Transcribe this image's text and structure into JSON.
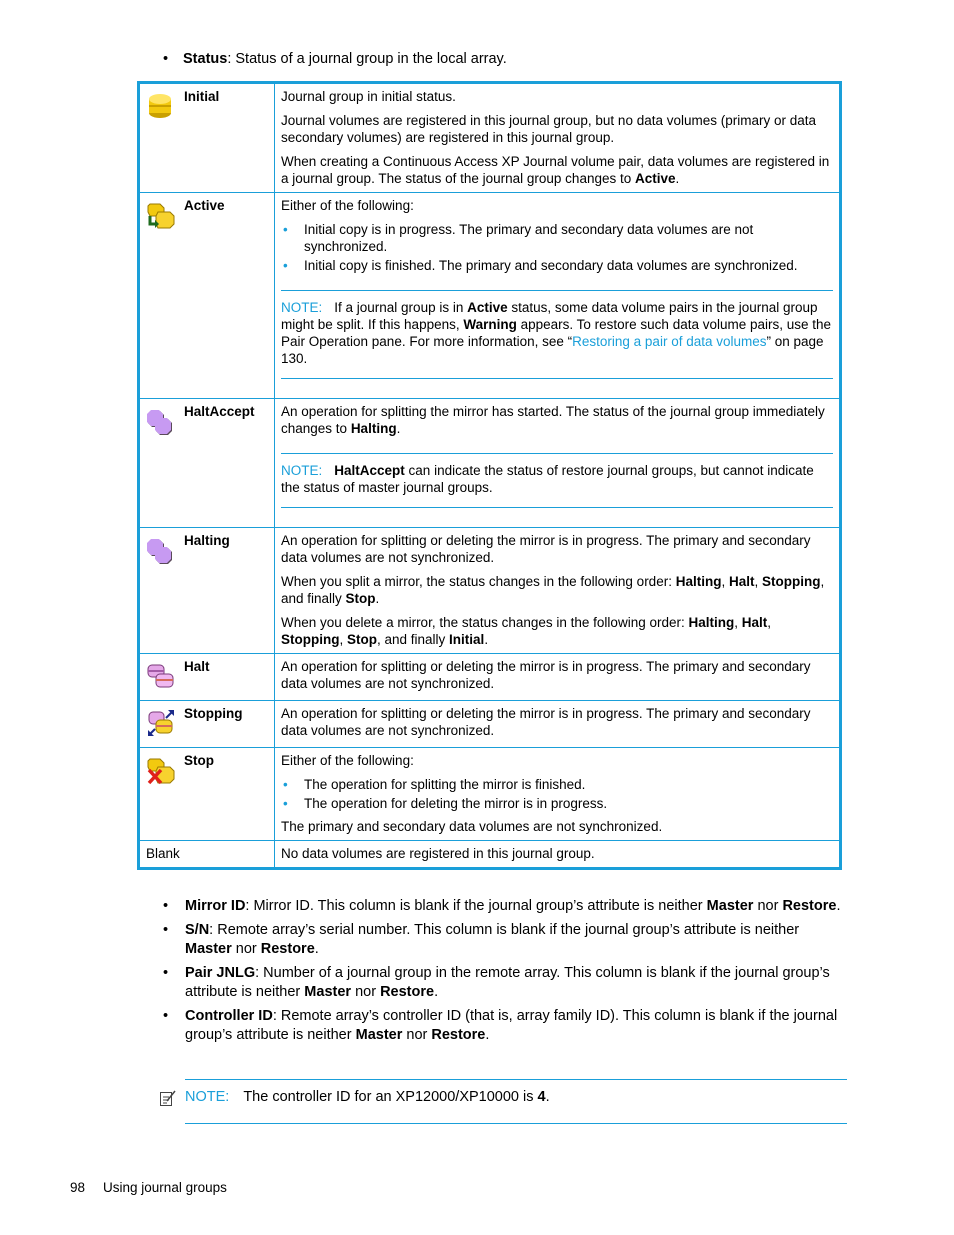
{
  "intro_bullet": {
    "term": "Status",
    "text": ": Status of a journal group in the local array."
  },
  "status_table": {
    "rows": [
      {
        "name": "Initial",
        "icon": "database-yellow-icon",
        "paragraphs": [
          "Journal group in initial status.",
          "Journal volumes are registered in this journal group, but no data volumes (primary or data secondary volumes) are registered in this journal group."
        ],
        "p3_pre": "When creating a Continuous Access XP Journal volume pair, data volumes are registered in a journal group. The status of the journal group changes to ",
        "p3_bold": "Active",
        "p3_post": "."
      },
      {
        "name": "Active",
        "icon": "database-active-arrow-icon",
        "lead": "Either of the following:",
        "bullets": [
          "Initial copy is in progress. The primary and secondary data volumes are not synchronized.",
          "Initial copy is finished. The primary and secondary data volumes are synchronized."
        ],
        "note": {
          "label": "NOTE:",
          "t1": "If a journal group is in ",
          "b1": "Active",
          "t2": " status, some data volume pairs in the journal group might be split. If this happens, ",
          "b2": "Warning",
          "t3": " appears. To restore such data volume pairs, use the Pair Operation pane. For more information, see “",
          "link": "Restoring a pair of data volumes",
          "t4": "” on page 130."
        }
      },
      {
        "name": "HaltAccept",
        "icon": "halt-accept-purple-icon",
        "p_pre": "An operation for splitting the mirror has started. The status of the journal group immediately changes to ",
        "p_bold": "Halting",
        "p_post": ".",
        "note": {
          "label": "NOTE:",
          "b1": "HaltAccept",
          "t1": " can indicate the status of restore journal groups, but cannot indicate the status of master journal groups."
        }
      },
      {
        "name": "Halting",
        "icon": "halting-purple-icon",
        "p1": "An operation for splitting or deleting the mirror is in progress. The primary and secondary data volumes are not synchronized.",
        "p2": {
          "t1": "When you split a mirror, the status changes in the following order: ",
          "b1": "Halting",
          "s1": ", ",
          "b2": "Halt",
          "s2": ", ",
          "b3": "Stopping",
          "t2": ", and finally ",
          "b4": "Stop",
          "t3": "."
        },
        "p3": {
          "t1": "When you delete a mirror, the status changes in the following order: ",
          "b1": "Halting",
          "s1": ", ",
          "b2": "Halt",
          "s2": ", ",
          "b3": "Stopping",
          "s3": ", ",
          "b4": "Stop",
          "t2": ", and finally ",
          "b5": "Initial",
          "t3": "."
        }
      },
      {
        "name": "Halt",
        "icon": "database-pink-icon",
        "p1": "An operation for splitting or deleting the mirror is in progress. The primary and secondary data volumes are not synchronized."
      },
      {
        "name": "Stopping",
        "icon": "database-stopping-arrows-icon",
        "p1": "An operation for splitting or deleting the mirror is in progress. The primary and secondary data volumes are not synchronized."
      },
      {
        "name": "Stop",
        "icon": "database-stop-x-icon",
        "lead": "Either of the following:",
        "bullets": [
          "The operation for splitting the mirror is finished.",
          "The operation for deleting the mirror is in progress."
        ],
        "tail": "The primary and secondary data volumes are not synchronized."
      },
      {
        "name": "Blank",
        "p1": "No data volumes are registered in this journal group."
      }
    ]
  },
  "main_bullets": [
    {
      "term": "Mirror ID",
      "t1": ": Mirror ID. This column is blank if the journal group’s attribute is neither ",
      "b1": "Master",
      "t2": " nor ",
      "b2": "Restore",
      "t3": "."
    },
    {
      "term": "S/N",
      "t1": ": Remote array’s serial number. This column is blank if the journal group’s attribute is neither ",
      "b1": "Master",
      "t2": " nor ",
      "b2": "Restore",
      "t3": "."
    },
    {
      "term": "Pair JNLG",
      "t1": ": Number of a journal group in the remote array. This column is blank if the journal group’s attribute is neither ",
      "b1": "Master",
      "t2": " nor ",
      "b2": "Restore",
      "t3": "."
    },
    {
      "term": "Controller ID",
      "t1": ": Remote array’s controller ID (that is, array family ID). This column is blank if the journal group’s attribute is neither ",
      "b1": "Master",
      "t2": " nor ",
      "b2": "Restore",
      "t3": "."
    }
  ],
  "bottom_note": {
    "icon": "note-pencil-icon",
    "label": "NOTE:",
    "text": "The controller ID for an XP12000/XP10000 is ",
    "bold": "4",
    "end": "."
  },
  "footer": {
    "page_number": "98",
    "section": "Using journal groups"
  },
  "colors": {
    "accent": "#1a9fd9"
  }
}
